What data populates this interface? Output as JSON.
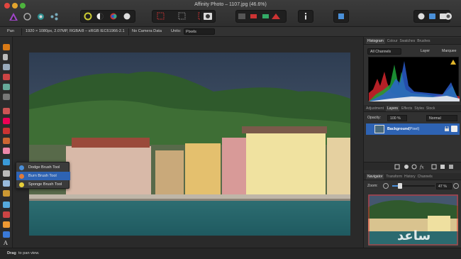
{
  "window": {
    "title": "Affinity Photo – 1107.jpg (46.6%)"
  },
  "context_toolbar": {
    "tool_name": "Pan",
    "document_info": "1920 × 1080px, 2.07MP, RGBA/8 – sRGB IEC61966-2.1",
    "camera_data": "No Camera Data",
    "units_label": "Units:",
    "units_value": "Pixels"
  },
  "brush_menu": {
    "items": [
      {
        "label": "Dodge Brush Tool",
        "selected": false
      },
      {
        "label": "Burn Brush Tool",
        "selected": true
      },
      {
        "label": "Sponge Brush Tool",
        "selected": false
      }
    ]
  },
  "histogram_panel": {
    "tabs": [
      "Histogram",
      "Colour",
      "Swatches",
      "Brushes"
    ],
    "channel_select": "All Channels",
    "layer_button": "Layer",
    "marquee_button": "Marquee",
    "warning_icon": "warning-icon"
  },
  "layers_panel": {
    "tabs": [
      "Adjustment",
      "Layers",
      "Effects",
      "Styles",
      "Stock"
    ],
    "opacity_label": "Opacity:",
    "opacity_value": "100 %",
    "blend_mode": "Normal",
    "layer_name": "Background",
    "layer_type": "(Pixel)"
  },
  "navigator_panel": {
    "tabs": [
      "Navigator",
      "Transform",
      "History",
      "Channels"
    ],
    "zoom_label": "Zoom:",
    "zoom_value": "47 %"
  },
  "status": {
    "hint_bold": "Drag",
    "hint_text": "to pan view."
  },
  "watermark": "ساعد",
  "colors": {
    "accent": "#2e63b3",
    "panel": "#313131",
    "toolbar": "#2c2c2c"
  }
}
